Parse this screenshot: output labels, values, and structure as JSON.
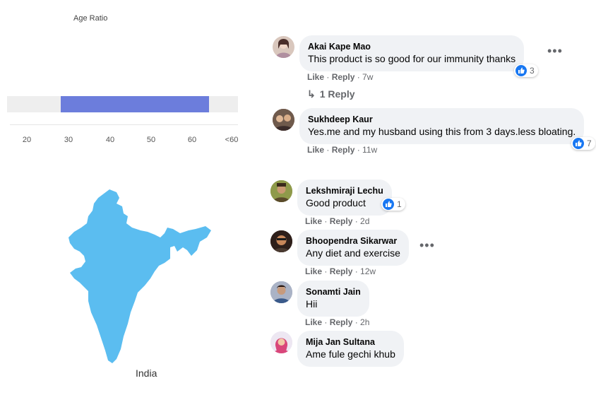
{
  "age_panel": {
    "title": "Age Ratio",
    "range_start": 23,
    "range_end": 59,
    "axis_min": 10,
    "axis_max": 66,
    "ticks": [
      "20",
      "30",
      "40",
      "50",
      "60",
      "<60"
    ]
  },
  "map": {
    "label": "India",
    "fill_color": "#5bbdf0"
  },
  "colors": {
    "bar": "#6c7ddc",
    "like_blue": "#1877f2",
    "bubble": "#f0f2f5",
    "meta": "#65676b"
  },
  "actions": {
    "like": "Like",
    "reply": "Reply",
    "sep": " · "
  },
  "comments": [
    {
      "name": "Akai Kape Mao",
      "text": "This product is so good for our immunity thanks",
      "time": "7w",
      "reactions": "3",
      "replies": "1 Reply"
    },
    {
      "name": "Sukhdeep Kaur",
      "text": "Yes.me and my husband using this from 3 days.less bloating.",
      "time": "11w",
      "reactions": "7"
    },
    {
      "name": "Lekshmiraji Lechu",
      "text": "Good product",
      "time": "2d",
      "reactions": "1"
    },
    {
      "name": "Bhoopendra Sikarwar",
      "text": "Any diet and exercise",
      "time": "12w"
    },
    {
      "name": "Sonamti Jain",
      "text": "Hii",
      "time": "2h"
    },
    {
      "name": "Mija Jan Sultana",
      "text": "Ame fule gechi khub"
    }
  ]
}
